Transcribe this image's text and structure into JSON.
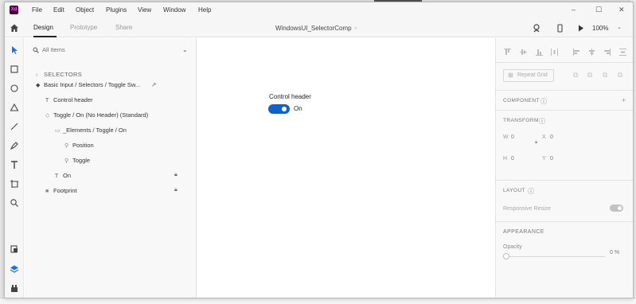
{
  "menu": {
    "items": [
      "File",
      "Edit",
      "Object",
      "Plugins",
      "View",
      "Window",
      "Help"
    ],
    "window_controls": [
      "–",
      "☐",
      "✕"
    ]
  },
  "toolbar": {
    "tabs": [
      "Design",
      "Prototype",
      "Share"
    ],
    "active_tab": "Design",
    "document_title": "WindowsUI_SelectorComp",
    "zoom": "100%"
  },
  "layers": {
    "search_placeholder": "All Items",
    "breadcrumb": "SELECTORS",
    "rows": [
      {
        "label": "Basic Input / Selectors / Toggle Sw...",
        "icon": "component-icon",
        "locked": false
      },
      {
        "label": "Control header",
        "icon": "text-icon",
        "locked": false
      },
      {
        "label": "Toggle / On (No Header) (Standard)",
        "icon": "component-icon",
        "locked": false
      },
      {
        "label": "_Elements / Toggle / On",
        "icon": "group-icon",
        "locked": false
      },
      {
        "label": "Position",
        "icon": "link-icon",
        "locked": false
      },
      {
        "label": "Toggle",
        "icon": "link-icon",
        "locked": false
      },
      {
        "label": "On",
        "icon": "text-icon",
        "locked": true
      },
      {
        "label": "Footprint",
        "icon": "rectangle-icon",
        "locked": true
      }
    ]
  },
  "canvas": {
    "control_header": "Control header",
    "toggle_label": "On",
    "toggle_on": true,
    "accent": "#0f62c9"
  },
  "props": {
    "repeat_grid": "Repeat Grid",
    "component_label": "COMPONENT",
    "transform_label": "TRANSFORM",
    "w_label": "W",
    "w_value": "0",
    "x_label": "X",
    "x_value": "0",
    "h_label": "H",
    "h_value": "0",
    "y_label": "Y",
    "y_value": "0",
    "layout_label": "LAYOUT",
    "responsive_resize": "Responsive Resize",
    "appearance_label": "APPEARANCE",
    "opacity_label": "Opacity",
    "opacity_value": "0 %",
    "add_symbol": "+",
    "info_symbol": "ⓘ"
  }
}
